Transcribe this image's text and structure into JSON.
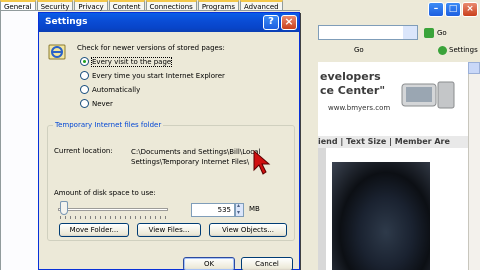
{
  "internet_options": {
    "tabs": [
      "General",
      "Security",
      "Privacy",
      "Content",
      "Connections",
      "Programs",
      "Advanced"
    ],
    "active_tab": "General"
  },
  "settings_dialog": {
    "title": "Settings",
    "help_glyph": "?",
    "close_glyph": "×",
    "check_label": "Check for newer versions of stored pages:",
    "radio_options": [
      {
        "label": "Every visit to the page",
        "selected": true
      },
      {
        "label": "Every time you start Internet Explorer",
        "selected": false
      },
      {
        "label": "Automatically",
        "selected": false
      },
      {
        "label": "Never",
        "selected": false
      }
    ],
    "group_title": "Temporary Internet files folder",
    "current_location_label": "Current location:",
    "current_location_line1": "C:\\Documents and Settings\\Bill\\Local",
    "current_location_line2": "Settings\\Temporary Internet Files\\",
    "disk_space_label": "Amount of disk space to use:",
    "disk_space_value": "535",
    "disk_space_unit": "MB",
    "disk_space_fraction": 0.02,
    "buttons": {
      "move_folder": "Move Folder...",
      "view_files": "View Files...",
      "view_objects": "View Objects...",
      "ok": "OK",
      "cancel": "Cancel"
    }
  },
  "browser": {
    "go_label": "Go",
    "go_label_2": "Go",
    "settings_label": "Settings",
    "banner_line1": "evelopers",
    "banner_line2": "ce Center\"",
    "banner_url": "www.bmyers.com",
    "nav_text": "iend | Text Size | Member Are"
  },
  "icons": {
    "help": "help-icon",
    "close": "close-icon",
    "cache": "internet-explorer-icon",
    "cursor": "mouse-pointer-icon"
  },
  "colors": {
    "title_bar": "#0a4dd6",
    "group_title": "#0046d5",
    "cursor": "#d01010"
  }
}
